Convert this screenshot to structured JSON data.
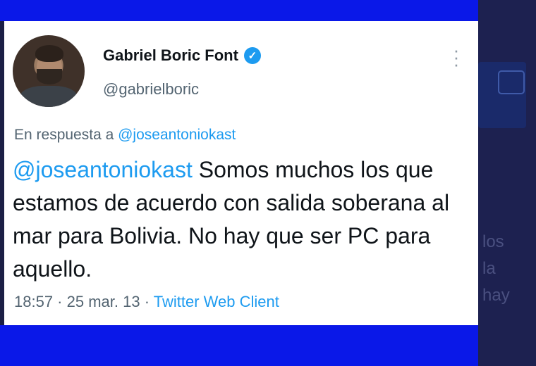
{
  "background_text": {
    "line1": "los",
    "line2": "la",
    "line3": "hay"
  },
  "tweet": {
    "author_name": "Gabriel Boric Font",
    "handle": "@gabrielboric",
    "reply_prefix": "En respuesta a",
    "reply_to": "@joseantoniokast",
    "body_mention": "@joseantoniokast",
    "body_text": " Somos muchos los que estamos de acuerdo con salida soberana al mar para Bolivia. No hay que ser PC para aquello.",
    "time": "18:57",
    "date": "25 mar. 13",
    "client": "Twitter Web Client",
    "separator": " · "
  },
  "icons": {
    "verified": "verified-badge-icon",
    "more": "more-options-icon"
  },
  "colors": {
    "link": "#1d9bf0",
    "frame": "#0a18e8",
    "secondary_text": "#536471"
  }
}
